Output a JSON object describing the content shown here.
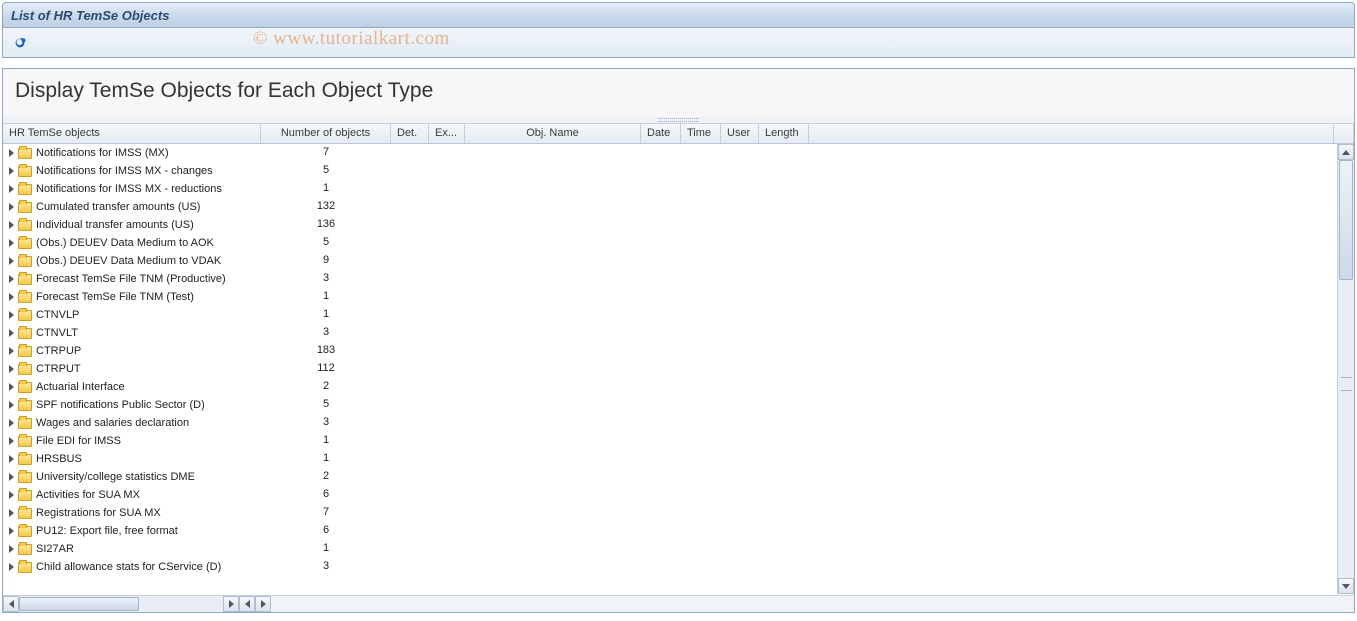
{
  "window": {
    "title": "List of HR TemSe Objects"
  },
  "watermark": "© www.tutorialkart.com",
  "heading": "Display TemSe Objects for Each Object Type",
  "columns": {
    "tree": "HR TemSe objects",
    "num": "Number of objects",
    "det": "Det.",
    "ex": "Ex...",
    "obj": "Obj. Name",
    "date": "Date",
    "time": "Time",
    "user": "User",
    "len": "Length"
  },
  "rows": [
    {
      "label": "Notifications for IMSS (MX)",
      "count": 7
    },
    {
      "label": "Notifications for IMSS MX - changes",
      "count": 5
    },
    {
      "label": "Notifications for IMSS MX - reductions",
      "count": 1
    },
    {
      "label": "Cumulated transfer amounts (US)",
      "count": 132
    },
    {
      "label": "Individual transfer amounts (US)",
      "count": 136
    },
    {
      "label": "(Obs.) DEUEV Data Medium to AOK",
      "count": 5
    },
    {
      "label": "(Obs.) DEUEV Data Medium to VDAK",
      "count": 9
    },
    {
      "label": "Forecast TemSe File TNM (Productive)",
      "count": 3
    },
    {
      "label": "Forecast TemSe File TNM (Test)",
      "count": 1
    },
    {
      "label": "CTNVLP",
      "count": 1
    },
    {
      "label": "CTNVLT",
      "count": 3
    },
    {
      "label": "CTRPUP",
      "count": 183
    },
    {
      "label": "CTRPUT",
      "count": 112
    },
    {
      "label": "Actuarial Interface",
      "count": 2
    },
    {
      "label": "SPF notifications Public Sector (D)",
      "count": 5
    },
    {
      "label": "Wages and salaries declaration",
      "count": 3
    },
    {
      "label": "File EDI for IMSS",
      "count": 1
    },
    {
      "label": "HRSBUS",
      "count": 1
    },
    {
      "label": "University/college statistics DME",
      "count": 2
    },
    {
      "label": "Activities for SUA MX",
      "count": 6
    },
    {
      "label": "Registrations for SUA MX",
      "count": 7
    },
    {
      "label": "PU12: Export file, free format",
      "count": 6
    },
    {
      "label": "SI27AR",
      "count": 1
    },
    {
      "label": "Child allowance stats for CService (D)",
      "count": 3
    }
  ]
}
